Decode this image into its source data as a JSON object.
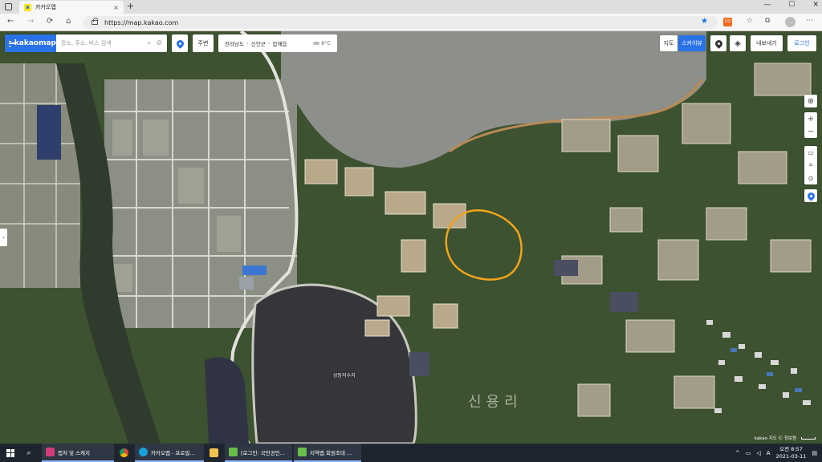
{
  "browser": {
    "tab_title": "카카오맵",
    "tab_close": "×",
    "new_tab": "+",
    "url": "https://map.kakao.com",
    "window_controls": {
      "minimize": "—",
      "maximize": "☐",
      "close": "✕"
    },
    "nav": {
      "back": "←",
      "forward": "→",
      "reload": "⟳",
      "home": "⌂"
    },
    "toolbar_icons": [
      "star-icon",
      "extension-icon",
      "favorites-icon",
      "collections-icon",
      "profile-icon",
      "more-icon"
    ],
    "ext_label": "CO",
    "more": "···",
    "accent": "#1a73e8"
  },
  "map": {
    "logo": "kakaomap",
    "search_placeholder": "장소, 주소, 버스 검색",
    "nearby_label": "주변",
    "breadcrumb": [
      "전라남도",
      "신안군",
      "압해읍"
    ],
    "weather": "8°C",
    "view_map": "지도",
    "view_skyview": "스카이뷰",
    "export_label": "내보내기",
    "login_label": "로그인",
    "reservoir_label": "상동저수지",
    "village_label": "신용리",
    "copyright": "kakao 지도 Ⓒ 정보원",
    "brand_color": "#2a72e5",
    "highlight_color": "#f2a51a"
  },
  "taskbar": {
    "items": [
      {
        "label": "캡처 및 스케치",
        "icon": "snip-icon"
      },
      {
        "label": "",
        "icon": "chrome-icon"
      },
      {
        "label": "카카오맵 - 프로필...",
        "icon": "edge-icon"
      },
      {
        "label": "",
        "icon": "folder-icon"
      },
      {
        "label": "[로그인: 국민공인...",
        "icon": "hwp-icon"
      },
      {
        "label": "지역맵 회원조대 ...",
        "icon": "hwp-icon"
      }
    ],
    "tray": {
      "ime": "A",
      "time": "오전 8:57",
      "date": "2021-03-11",
      "chevron": "^"
    }
  }
}
